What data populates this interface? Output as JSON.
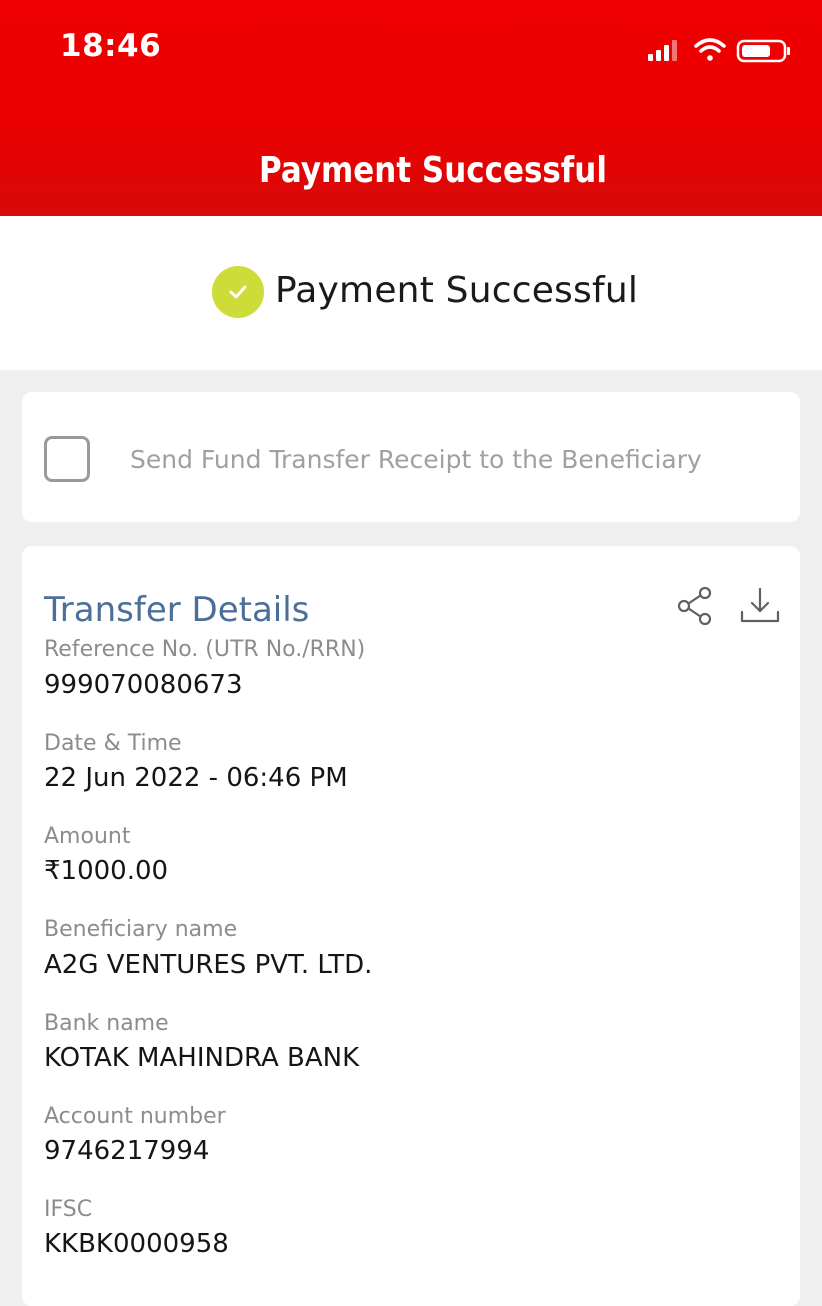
{
  "status_bar": {
    "time": "18:46"
  },
  "header": {
    "title": "Payment Successful",
    "background_color": "#ec0000"
  },
  "success_banner": {
    "text": "Payment Successful",
    "icon": "check-circle-icon",
    "icon_color": "#cddc39"
  },
  "receipt_option": {
    "label": "Send Fund Transfer Receipt to the Beneficiary",
    "checked": false
  },
  "transfer_details": {
    "title": "Transfer Details",
    "title_color": "#4b6e9a",
    "actions": [
      "share-icon",
      "download-icon"
    ],
    "fields": [
      {
        "label": "Reference No. (UTR No./RRN)",
        "value": "999070080673"
      },
      {
        "label": "Date & Time",
        "value": "22 Jun 2022 - 06:46 PM"
      },
      {
        "label": "Amount",
        "value": "₹1000.00"
      },
      {
        "label": "Beneficiary name",
        "value": "A2G VENTURES PVT. LTD."
      },
      {
        "label": "Bank name",
        "value": "KOTAK MAHINDRA BANK"
      },
      {
        "label": "Account number",
        "value": "9746217994"
      },
      {
        "label": "IFSC",
        "value": "KKBK0000958"
      }
    ]
  }
}
